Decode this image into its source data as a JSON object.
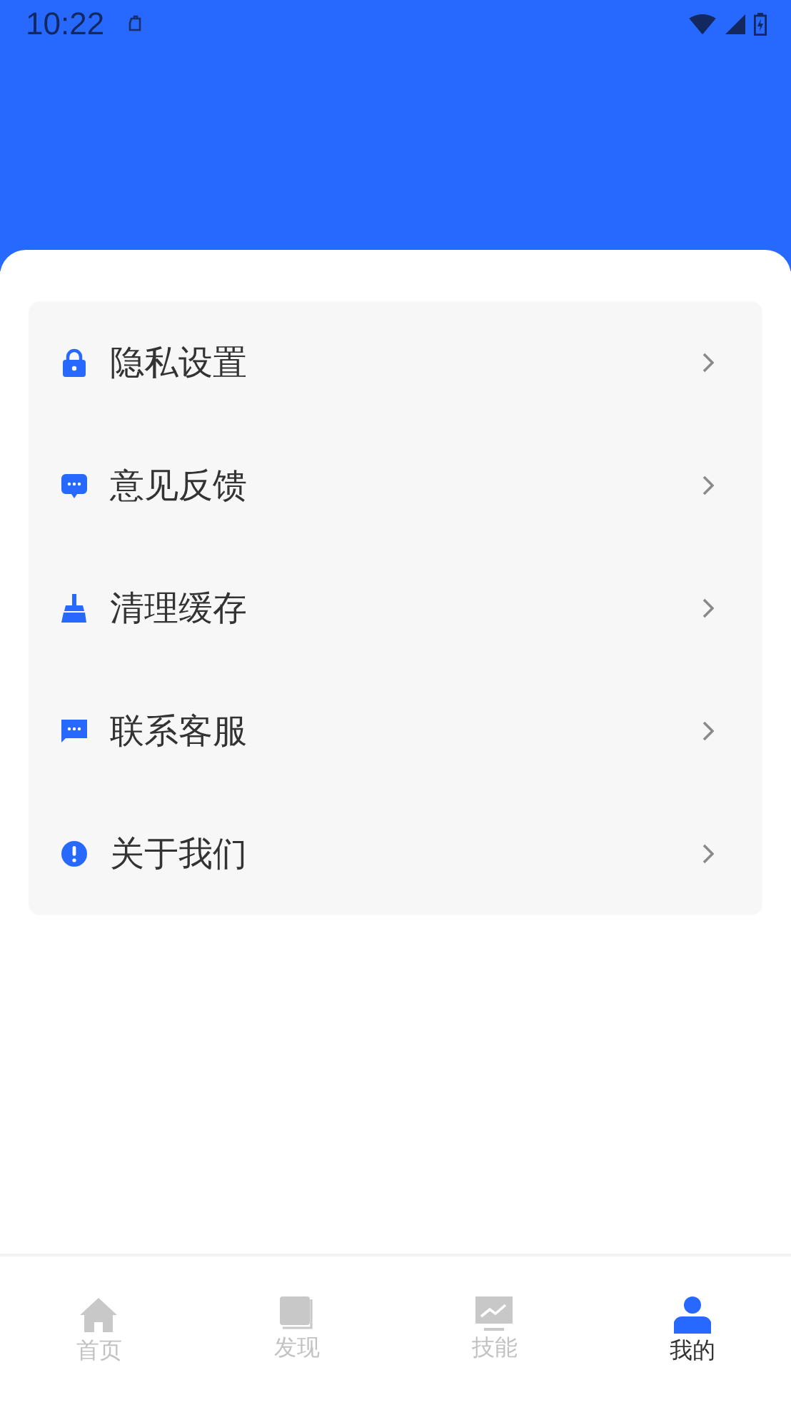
{
  "status_bar": {
    "time": "10:22"
  },
  "menu": [
    {
      "kind": "lock",
      "label": "隐私设置"
    },
    {
      "kind": "feedback",
      "label": "意见反馈"
    },
    {
      "kind": "broom",
      "label": "清理缓存"
    },
    {
      "kind": "message",
      "label": "联系客服"
    },
    {
      "kind": "info",
      "label": "关于我们"
    }
  ],
  "tabs": [
    {
      "kind": "home",
      "label": "首页",
      "selected": false
    },
    {
      "kind": "book",
      "label": "发现",
      "selected": false
    },
    {
      "kind": "chart",
      "label": "技能",
      "selected": false
    },
    {
      "kind": "person",
      "label": "我的",
      "selected": true
    }
  ]
}
